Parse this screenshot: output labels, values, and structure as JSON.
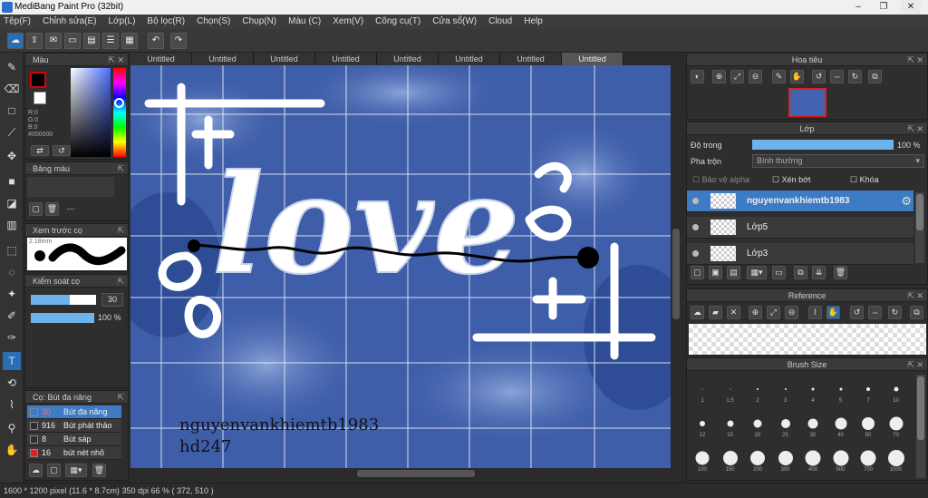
{
  "window": {
    "title": "MediBang Paint Pro (32bit)"
  },
  "menu": [
    "Tệp(F)",
    "Chỉnh sửa(E)",
    "Lớp(L)",
    "Bộ lọc(R)",
    "Chọn(S)",
    "Chụp(N)",
    "Màu (C)",
    "Xem(V)",
    "Công cụ(T)",
    "Cửa sổ(W)",
    "Cloud",
    "Help"
  ],
  "tabs": [
    "Untitled",
    "Untitled",
    "Untitled",
    "Untitled",
    "Untitled",
    "Untitled",
    "Untitled",
    "Untitled"
  ],
  "color_panel": {
    "title": "Màu",
    "r": "R:0",
    "g": "G:0",
    "b": "B:0",
    "hex": "#000000",
    "fg": "#000000",
    "bg": "#ffffff"
  },
  "palette_panel": {
    "title": "Bảng màu",
    "value": "---"
  },
  "preview_panel": {
    "title": "Xem trước cọ",
    "size": "2.18mm"
  },
  "brush_control": {
    "title": "Kiểm soát cọ",
    "size": "30",
    "opacity": "100 %",
    "opacity_value": 1.0,
    "size_fill": 0.6
  },
  "brush_list": {
    "title": "Cọ: Bút đa năng",
    "items": [
      {
        "size": "30",
        "name": "Bút đa năng",
        "color": "#3d7cc5",
        "selected": true
      },
      {
        "size": "916",
        "name": "Bút phát thảo",
        "color": "#2e2e2e",
        "selected": false
      },
      {
        "size": "8",
        "name": "Bút sáp",
        "color": "#2e2e2e",
        "selected": false
      },
      {
        "size": "16",
        "name": "bút nét nhỏ",
        "color": "#e02020",
        "selected": false
      }
    ]
  },
  "canvas": {
    "art_text": "love",
    "watermark_line1": "nguyenvankhiemtb1983",
    "watermark_line2": "hd247"
  },
  "navigator_panel": {
    "title": "Hoa tiêu"
  },
  "layer_panel": {
    "title": "Lớp",
    "opacity_label": "Độ trong",
    "opacity_value": "100 %",
    "opacity_fraction": 1.0,
    "blend_label": "Pha trộn",
    "blend_value": "Bình thường",
    "protect_alpha": "Bảo vệ alpha",
    "clipping": "Xén bớt",
    "lock": "Khóa",
    "layers": [
      {
        "name": "nguyenvankhiemtb1983",
        "selected": true
      },
      {
        "name": "Lớp5",
        "selected": false
      },
      {
        "name": "Lớp3",
        "selected": false
      }
    ]
  },
  "reference_panel": {
    "title": "Reference"
  },
  "brush_size_panel": {
    "title": "Brush Size",
    "sizes": [
      "1",
      "1.5",
      "2",
      "3",
      "4",
      "5",
      "7",
      "10",
      "12",
      "15",
      "20",
      "25",
      "30",
      "40",
      "50",
      "70",
      "100",
      "150",
      "200",
      "300",
      "400",
      "500",
      "700",
      "1000"
    ]
  },
  "status": {
    "dims": "1600 * 1200 pixel",
    "cm": "(11.6 * 8.7cm)",
    "dpi": "350 dpi",
    "zoom": "66 %",
    "coords": "( 372, 510 )"
  }
}
